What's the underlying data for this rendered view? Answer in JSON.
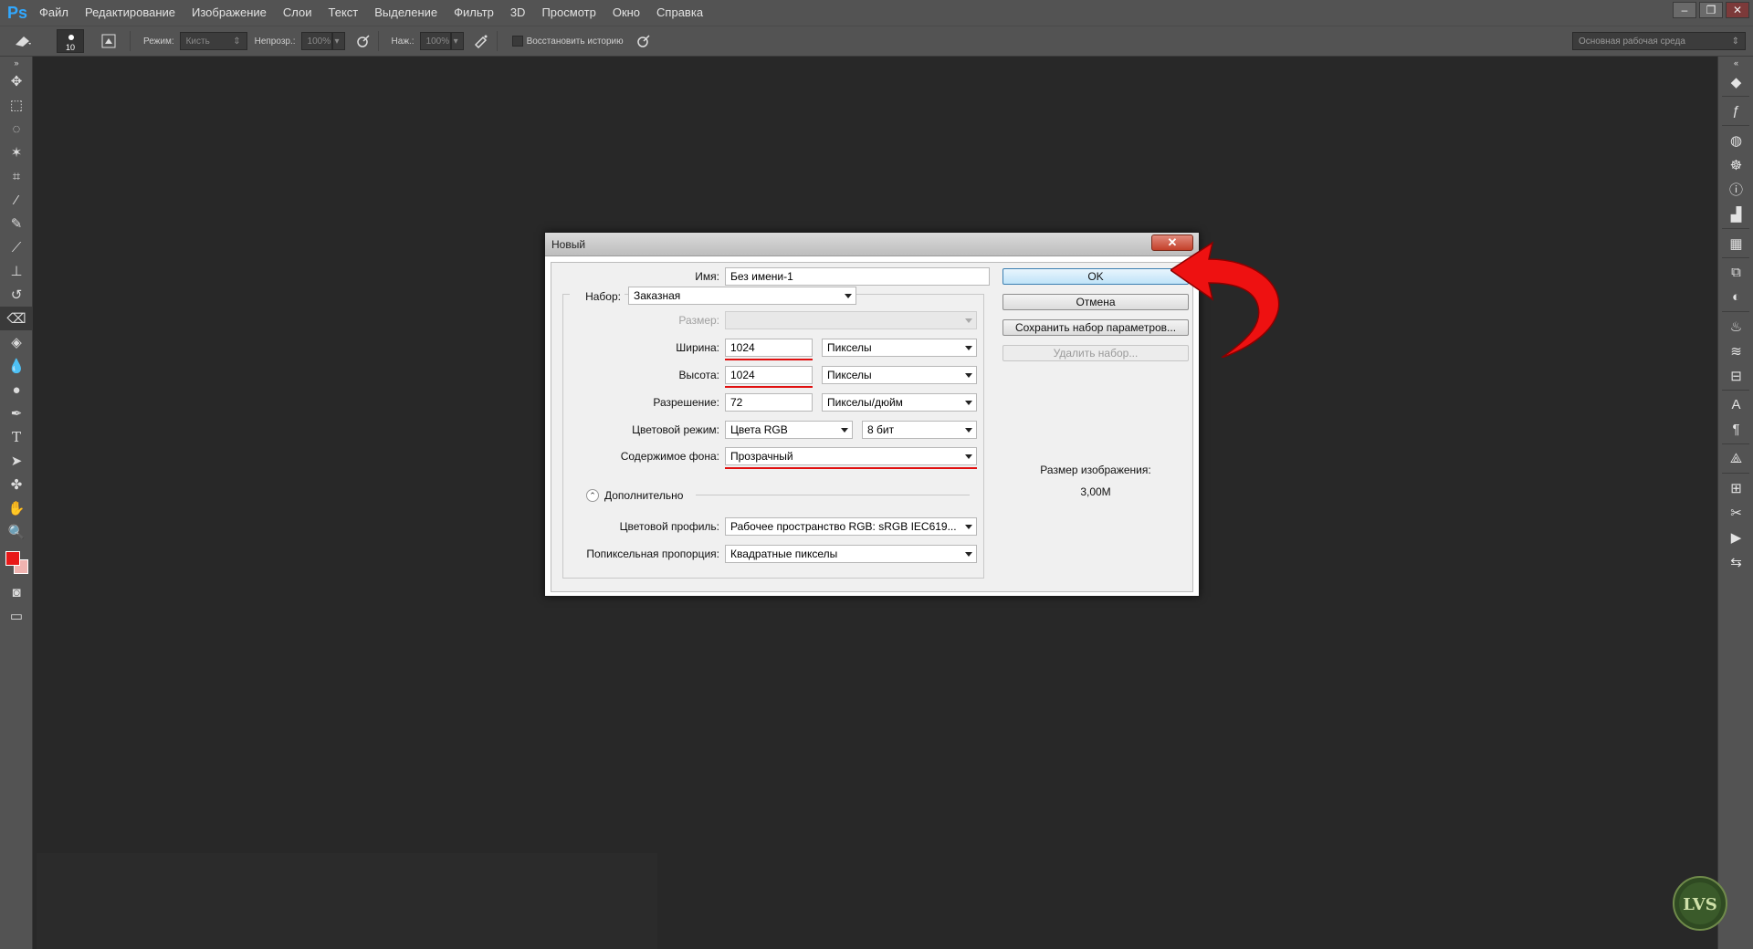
{
  "app": {
    "logo": "Ps",
    "menu": [
      "Файл",
      "Редактирование",
      "Изображение",
      "Слои",
      "Текст",
      "Выделение",
      "Фильтр",
      "3D",
      "Просмотр",
      "Окно",
      "Справка"
    ]
  },
  "options": {
    "brush_size": "10",
    "mode_label": "Режим:",
    "mode_value": "Кисть",
    "opacity_label": "Непрозр.:",
    "opacity_value": "100%",
    "flow_label": "Наж.:",
    "flow_value": "100%",
    "history_label": "Восстановить историю",
    "workspace": "Основная рабочая среда"
  },
  "colors": {
    "foreground": "#e81919",
    "background": "#f0b3b0",
    "accent": "#31a8ff"
  },
  "dialog": {
    "title": "Новый",
    "close": "✕",
    "name_label": "Имя:",
    "name_value": "Без имени-1",
    "preset_label": "Набор:",
    "preset_value": "Заказная",
    "size_label": "Размер:",
    "width_label": "Ширина:",
    "width_value": "1024",
    "width_unit": "Пикселы",
    "height_label": "Высота:",
    "height_value": "1024",
    "height_unit": "Пикселы",
    "resolution_label": "Разрешение:",
    "resolution_value": "72",
    "resolution_unit": "Пикселы/дюйм",
    "color_mode_label": "Цветовой режим:",
    "color_mode_value": "Цвета RGB",
    "bit_depth": "8 бит",
    "background_label": "Содержимое фона:",
    "background_value": "Прозрачный",
    "advanced_label": "Дополнительно",
    "profile_label": "Цветовой профиль:",
    "profile_value": "Рабочее пространство RGB:  sRGB IEC619...",
    "aspect_label": "Попиксельная пропорция:",
    "aspect_value": "Квадратные пикселы",
    "ok": "OK",
    "cancel": "Отмена",
    "save_preset": "Сохранить набор параметров...",
    "delete_preset": "Удалить набор...",
    "image_size_label": "Размер изображения:",
    "image_size_value": "3,00M"
  },
  "watermark": "LVS"
}
